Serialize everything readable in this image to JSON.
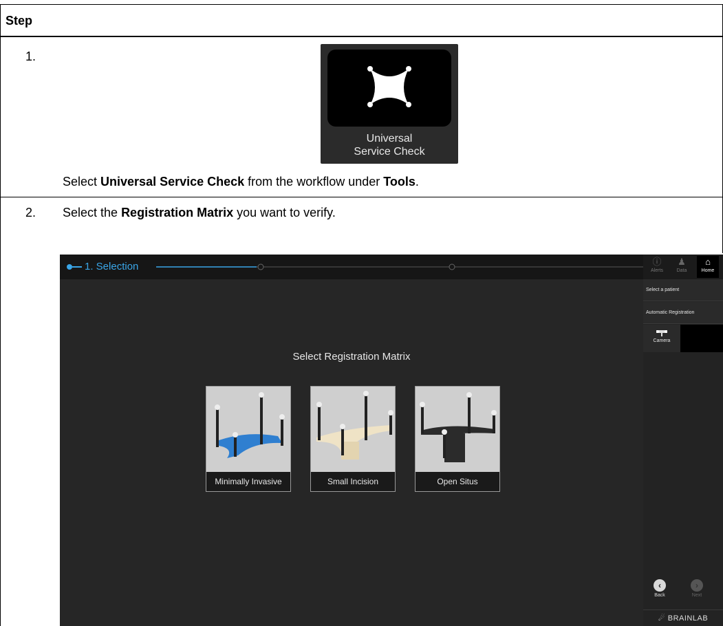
{
  "table": {
    "header": "Step",
    "rows": [
      {
        "number": "1.",
        "tile_label_line1": "Universal",
        "tile_label_line2": "Service Check",
        "text_pre": "Select ",
        "text_bold1": "Universal Service Check",
        "text_mid": " from the workflow under ",
        "text_bold2": "Tools",
        "text_post": "."
      },
      {
        "number": "2.",
        "text_pre": "Select the ",
        "text_bold1": "Registration Matrix",
        "text_post": " you want to verify."
      }
    ]
  },
  "app": {
    "breadcrumb": "1. Selection",
    "title": "Select Registration Matrix",
    "cards": [
      {
        "label": "Minimally Invasive",
        "color": "#2f7fd0"
      },
      {
        "label": "Small Incision",
        "color": "#efe3c6"
      },
      {
        "label": "Open Situs",
        "color": "#2b2b2b"
      }
    ],
    "top_buttons": [
      {
        "label": "Alerts",
        "icon": "alert-icon"
      },
      {
        "label": "Data",
        "icon": "data-icon"
      },
      {
        "label": "Home",
        "icon": "home-icon"
      }
    ],
    "menu": [
      "Select a patient",
      "Automatic Registration"
    ],
    "camera_label": "Camera",
    "back_label": "Back",
    "next_label": "Next",
    "brand": "BRAINLAB",
    "accent": "#3aa6e8"
  }
}
